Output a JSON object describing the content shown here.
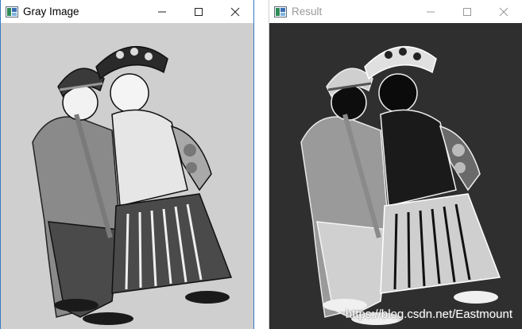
{
  "windows": [
    {
      "title": "Gray Image",
      "controls": {
        "minimize": "minimize-icon",
        "maximize": "maximize-icon",
        "close": "close-icon"
      }
    },
    {
      "title": "Result",
      "controls": {
        "minimize": "minimize-icon",
        "maximize": "maximize-icon",
        "close": "close-icon"
      }
    }
  ],
  "watermark": "https://blog.csdn.net/Eastmount",
  "colors": {
    "gray_bg": "#cfcfcf",
    "result_bg": "#2f2f2f",
    "active_border": "#3b78c5"
  }
}
